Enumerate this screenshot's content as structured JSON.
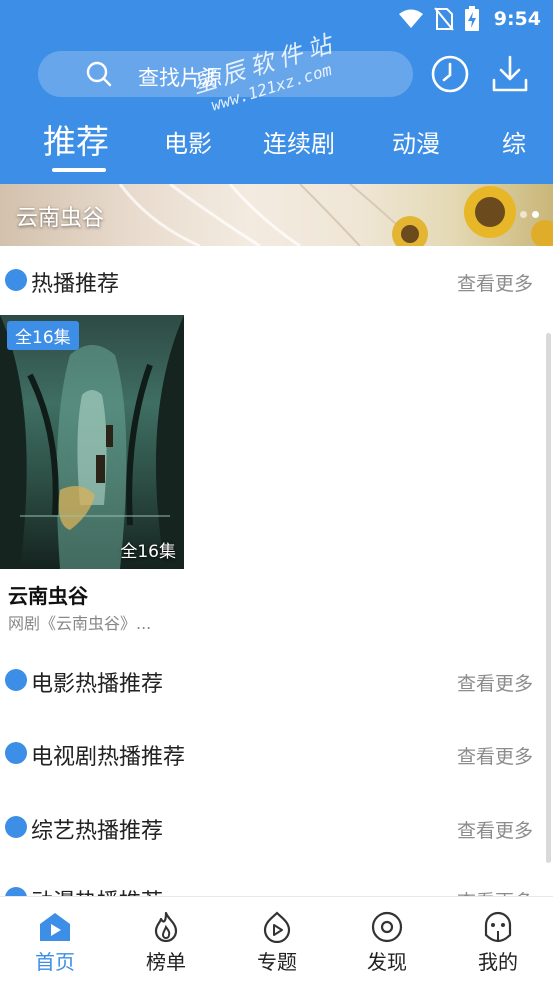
{
  "status_bar": {
    "time": "9:54"
  },
  "search": {
    "placeholder": "查找片源"
  },
  "watermark": {
    "name": "星辰软件站",
    "url": "www.121xz.com"
  },
  "tabs": [
    {
      "label": "推荐",
      "active": true
    },
    {
      "label": "电影"
    },
    {
      "label": "连续剧"
    },
    {
      "label": "动漫"
    },
    {
      "label": "综"
    }
  ],
  "banner": {
    "title": "云南虫谷",
    "slide_count": 2,
    "active_slide": 2
  },
  "sections": {
    "hot": {
      "title": "热播推荐",
      "more": "查看更多"
    },
    "movie": {
      "title": "电影热播推荐",
      "more": "查看更多"
    },
    "tv": {
      "title": "电视剧热播推荐",
      "more": "查看更多"
    },
    "variety": {
      "title": "综艺热播推荐",
      "more": "查看更多"
    },
    "anime": {
      "title": "动漫热播推荐",
      "more": "查看更多"
    }
  },
  "featured": {
    "badge": "全16集",
    "episodes": "全16集",
    "title": "云南虫谷",
    "subtitle": "网剧《云南虫谷》..."
  },
  "bottom_nav": [
    {
      "label": "首页",
      "icon": "home-icon",
      "active": true
    },
    {
      "label": "榜单",
      "icon": "flame-icon"
    },
    {
      "label": "专题",
      "icon": "topic-play-icon"
    },
    {
      "label": "发现",
      "icon": "discover-icon"
    },
    {
      "label": "我的",
      "icon": "profile-icon"
    }
  ],
  "colors": {
    "brand": "#3d8ee6",
    "muted": "#8c8c8c"
  }
}
